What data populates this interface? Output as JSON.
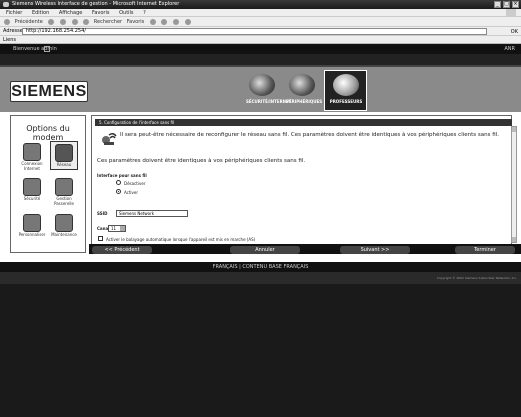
{
  "window": {
    "title": "Siemens Wireless Interface de gestion - Microsoft Internet Explorer",
    "menu": [
      "Fichier",
      "Edition",
      "Affichage",
      "Favoris",
      "Outils",
      "?"
    ],
    "toolbar": [
      "Précédente",
      "Rechercher",
      "Favoris"
    ],
    "address_label": "Adresse",
    "address_value": "http://192.168.254.254/",
    "go_label": "OK",
    "links_label": "Liens"
  },
  "topbar": {
    "welcome": "Bienvenue admin",
    "indicator": "ANR"
  },
  "header": {
    "logo": "SIEMENS",
    "tabs": [
      {
        "label": "SÉCURITÉ/INTERNET",
        "icon": "security-icon"
      },
      {
        "label": "PÉRIPHÉRIQUES",
        "icon": "devices-icon"
      },
      {
        "label": "PROFESSEURS",
        "icon": "router-icon",
        "active": true
      }
    ]
  },
  "sidebar": {
    "title": "Options du modem",
    "items": [
      {
        "label": "Connexion Internet",
        "icon": "internet-icon"
      },
      {
        "label": "Réseau",
        "icon": "network-icon",
        "selected": true
      },
      {
        "label": "Sécurité",
        "icon": "security-shield-icon"
      },
      {
        "label": "Gestion Passerelle",
        "icon": "gateway-icon"
      },
      {
        "label": "Personnaliser",
        "icon": "customize-icon"
      },
      {
        "label": "Maintenance",
        "icon": "maintenance-icon"
      }
    ]
  },
  "main": {
    "section_title": "5. Configuration de l'interface sans fil",
    "intro": "Il sera peut-être nécessaire de reconfigurer le réseau sans fil. Ces paramètres doivent être identiques à vos périphériques clients sans fil.",
    "note": "Ces paramètres doivent être identiques à vos périphériques clients sans fil.",
    "interface_label": "Interface pour sans fil",
    "radio_options": [
      {
        "label": "Désactiver",
        "checked": false
      },
      {
        "label": "Activer",
        "checked": true
      }
    ],
    "ssid_label": "SSID",
    "ssid_value": "Siemens Network",
    "channel_label": "Canal",
    "channel_value": "11",
    "autoscan_label": "Activer le balayage automatique lorsque l'appareil est mis en marche (AS)"
  },
  "buttons": {
    "back": "<< Précédent",
    "cancel": "Annuler",
    "next": "Suivant >>",
    "finish": "Terminer"
  },
  "footer": {
    "text": "FRANÇAIS | CONTENU BASE FRANÇAIS",
    "copyright": "Copyright © 2002 Siemens Subscriber Networks, Inc."
  }
}
